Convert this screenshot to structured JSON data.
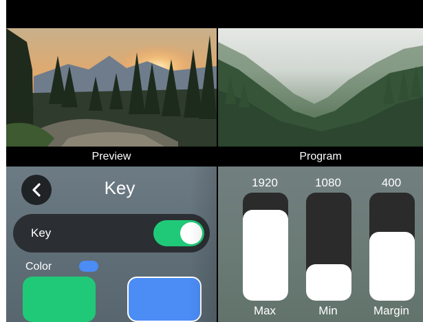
{
  "monitors": {
    "preview_label": "Preview",
    "program_label": "Program"
  },
  "key_panel": {
    "title": "Key",
    "back_icon": "chevron-left-icon",
    "key_toggle": {
      "label": "Key",
      "on": true
    },
    "color_label": "Color",
    "selected_color": "#4b8cf5",
    "swatches": [
      "#20c978",
      "#4b8cf5"
    ]
  },
  "sliders": [
    {
      "label": "Max",
      "value": "1920",
      "fill": 0.84
    },
    {
      "label": "Min",
      "value": "1080",
      "fill": 0.34
    },
    {
      "label": "Margin",
      "value": "400",
      "fill": 0.64
    }
  ],
  "colors": {
    "accent_green": "#20c978",
    "accent_blue": "#4b8cf5"
  }
}
